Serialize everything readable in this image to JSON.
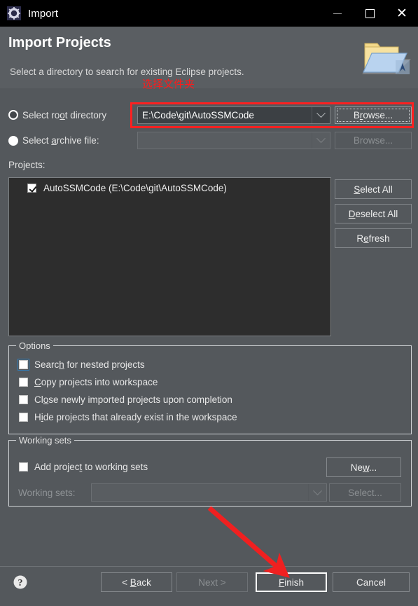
{
  "window": {
    "title": "Import",
    "icon": "eclipse-gear-icon",
    "controls": {
      "minimize": "minimize-icon",
      "maximize": "maximize-icon",
      "close": "close-icon"
    }
  },
  "header": {
    "title": "Import Projects",
    "description": "Select a directory to search for existing Eclipse projects.",
    "icon": "import-folder-icon",
    "annotation": "选择文件夹"
  },
  "source": {
    "root_directory": {
      "radio_label": "Select root directory",
      "radio_selected": true,
      "value": "E:\\Code\\git\\AutoSSMCode",
      "browse_label": "Browse...",
      "browse_enabled": true
    },
    "archive_file": {
      "radio_label": "Select archive file:",
      "radio_selected": false,
      "value": "",
      "browse_label": "Browse...",
      "browse_enabled": false
    }
  },
  "projects": {
    "label": "Projects:",
    "items": [
      {
        "label": "AutoSSMCode (E:\\Code\\git\\AutoSSMCode)",
        "checked": true
      }
    ],
    "buttons": [
      {
        "label": "Select All",
        "mnemonic_index": 1
      },
      {
        "label": "Deselect All",
        "mnemonic_index": 0
      },
      {
        "label": "Refresh",
        "mnemonic_index": 2
      }
    ]
  },
  "options": {
    "title": "Options",
    "items": [
      {
        "label": "Search for nested projects",
        "checked": false,
        "focused": true
      },
      {
        "label": "Copy projects into workspace",
        "checked": false,
        "focused": false
      },
      {
        "label": "Close newly imported projects upon completion",
        "checked": false,
        "focused": false
      },
      {
        "label": "Hide projects that already exist in the workspace",
        "checked": false,
        "focused": false
      }
    ]
  },
  "working_sets": {
    "title": "Working sets",
    "add_checkbox_label": "Add project to working sets",
    "add_checked": false,
    "new_button": "New...",
    "combo_label": "Working sets:",
    "combo_value": "",
    "combo_enabled": false,
    "select_button": "Select...",
    "select_enabled": false
  },
  "footer": {
    "help_icon": "help-icon",
    "back": "< Back",
    "next": "Next >",
    "finish": "Finish",
    "cancel": "Cancel",
    "back_enabled": true,
    "next_enabled": false,
    "finish_enabled": true,
    "cancel_enabled": true
  },
  "annotations": {
    "highlight_color": "#ff2020",
    "arrow_color": "#f02020",
    "text_color": "#ff1a1a"
  },
  "colors": {
    "dialog_bg": "#54585c",
    "header_bg": "#5a5e62",
    "titlebar_bg": "#000000",
    "list_bg": "#2d2d2d",
    "field_bg": "#3c4044",
    "border": "#7d8184",
    "text": "#e6e6e6",
    "text_disabled": "#8f9396",
    "focus_blue": "#2f7cb8"
  }
}
